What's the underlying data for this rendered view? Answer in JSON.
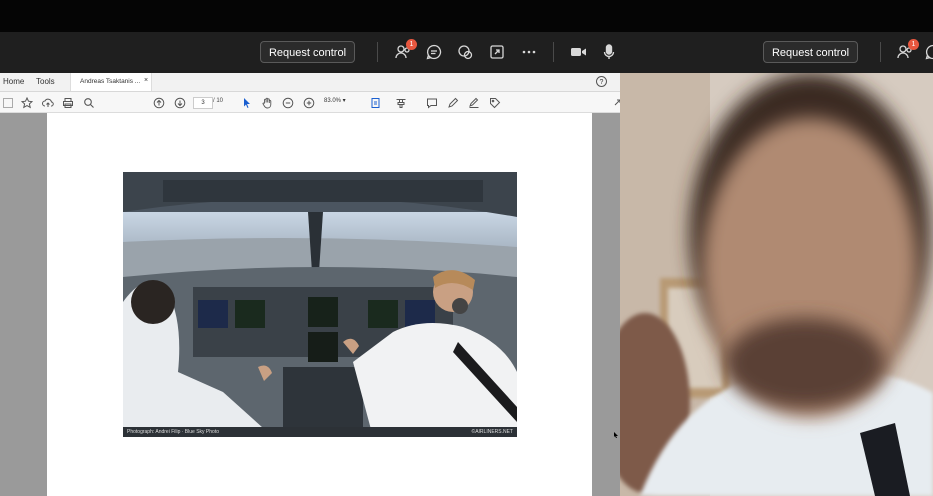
{
  "meeting_toolbar": {
    "request_control_label": "Request control",
    "people_badge": "1",
    "request_control_label_2": "Request control",
    "people_badge_2": "1"
  },
  "acrobat": {
    "tabs": {
      "home": "Home",
      "tools": "Tools",
      "document": "Andreas Tsaktanis ...",
      "close": "×"
    },
    "help": "?",
    "page_current": "3",
    "page_total": "/ 10",
    "zoom": "83.0%"
  },
  "document": {
    "photo_caption": "Photograph: Andrei Filip · Blue Sky Photo",
    "photo_credit": "©AIRLINERS.NET"
  },
  "colors": {
    "meeting_bar": "#1f1f1f",
    "badge": "#e8573f",
    "acrobat_bg": "#9a9a9a"
  }
}
